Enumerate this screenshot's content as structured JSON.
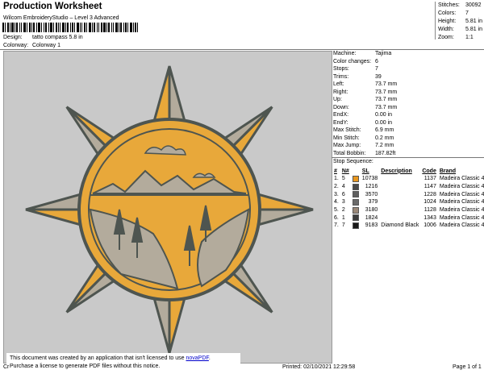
{
  "header": {
    "title": "Production Worksheet",
    "subtitle": "Wilcom EmbroideryStudio – Level 3 Advanced",
    "design_label": "Design:",
    "design_value": "tatto compass 5.8 in",
    "colorway_label": "Colorway:",
    "colorway_value": "Colorway 1"
  },
  "stats": [
    {
      "label": "Stitches:",
      "value": "30092"
    },
    {
      "label": "Colors:",
      "value": "7"
    },
    {
      "label": "Height:",
      "value": "5.81 in"
    },
    {
      "label": "Width:",
      "value": "5.81 in"
    },
    {
      "label": "Zoom:",
      "value": "1:1"
    }
  ],
  "machine_info": [
    {
      "label": "Machine:",
      "value": "Tajima"
    },
    {
      "label": "Color changes:",
      "value": "6"
    },
    {
      "label": "Stops:",
      "value": "7"
    },
    {
      "label": "Trims:",
      "value": "39"
    },
    {
      "label": "Left:",
      "value": "73.7 mm"
    },
    {
      "label": "Right:",
      "value": "73.7 mm"
    },
    {
      "label": "Up:",
      "value": "73.7 mm"
    },
    {
      "label": "Down:",
      "value": "73.7 mm"
    },
    {
      "label": "EndX:",
      "value": "0.00 in"
    },
    {
      "label": "EndY:",
      "value": "0.00 in"
    },
    {
      "label": "Max Stitch:",
      "value": "6.9 mm"
    },
    {
      "label": "Min Stitch:",
      "value": "0.2 mm"
    },
    {
      "label": "Max Jump:",
      "value": "7.2 mm"
    },
    {
      "label": "Total Bobbin:",
      "value": "187.82ft"
    }
  ],
  "stop_sequence": {
    "title": "Stop Sequence:",
    "headers": [
      "#",
      "N#",
      "",
      "SL",
      "Description",
      "Code",
      "Brand"
    ],
    "rows": [
      {
        "num": "1.",
        "n": "5",
        "color": "#e8961e",
        "sl": "10738",
        "desc": "",
        "code": "1137",
        "brand": "Madeira Classic 40"
      },
      {
        "num": "2.",
        "n": "4",
        "color": "#4a4a4a",
        "sl": "1216",
        "desc": "",
        "code": "1147",
        "brand": "Madeira Classic 40"
      },
      {
        "num": "3.",
        "n": "6",
        "color": "#5e5e5e",
        "sl": "3570",
        "desc": "",
        "code": "1228",
        "brand": "Madeira Classic 40"
      },
      {
        "num": "4.",
        "n": "3",
        "color": "#6a6a6a",
        "sl": "379",
        "desc": "",
        "code": "1024",
        "brand": "Madeira Classic 40"
      },
      {
        "num": "5.",
        "n": "2",
        "color": "#9a8878",
        "sl": "3180",
        "desc": "",
        "code": "1128",
        "brand": "Madeira Classic 40"
      },
      {
        "num": "6.",
        "n": "1",
        "color": "#3c3c3c",
        "sl": "1824",
        "desc": "",
        "code": "1343",
        "brand": "Madeira Classic 40"
      },
      {
        "num": "7.",
        "n": "7",
        "color": "#1a1a1a",
        "sl": "9183",
        "desc": "Diamond Black",
        "code": "1006",
        "brand": "Madeira Classic 40"
      }
    ]
  },
  "notice": {
    "line1_prefix": "This document was created by an application that isn't licensed to use ",
    "link": "novaPDF",
    "line1_suffix": ".",
    "line2": "Purchase a license to generate PDF files without this notice."
  },
  "footer": {
    "left": "Cr",
    "printed": "Printed: 02/10/2021 12:29:58",
    "page": "Page 1 of 1"
  },
  "colors": {
    "design_bg": "#c9c9c9",
    "star_orange": "#e8a83a",
    "star_gray": "#b3ab9c",
    "outline": "#4e5550"
  }
}
